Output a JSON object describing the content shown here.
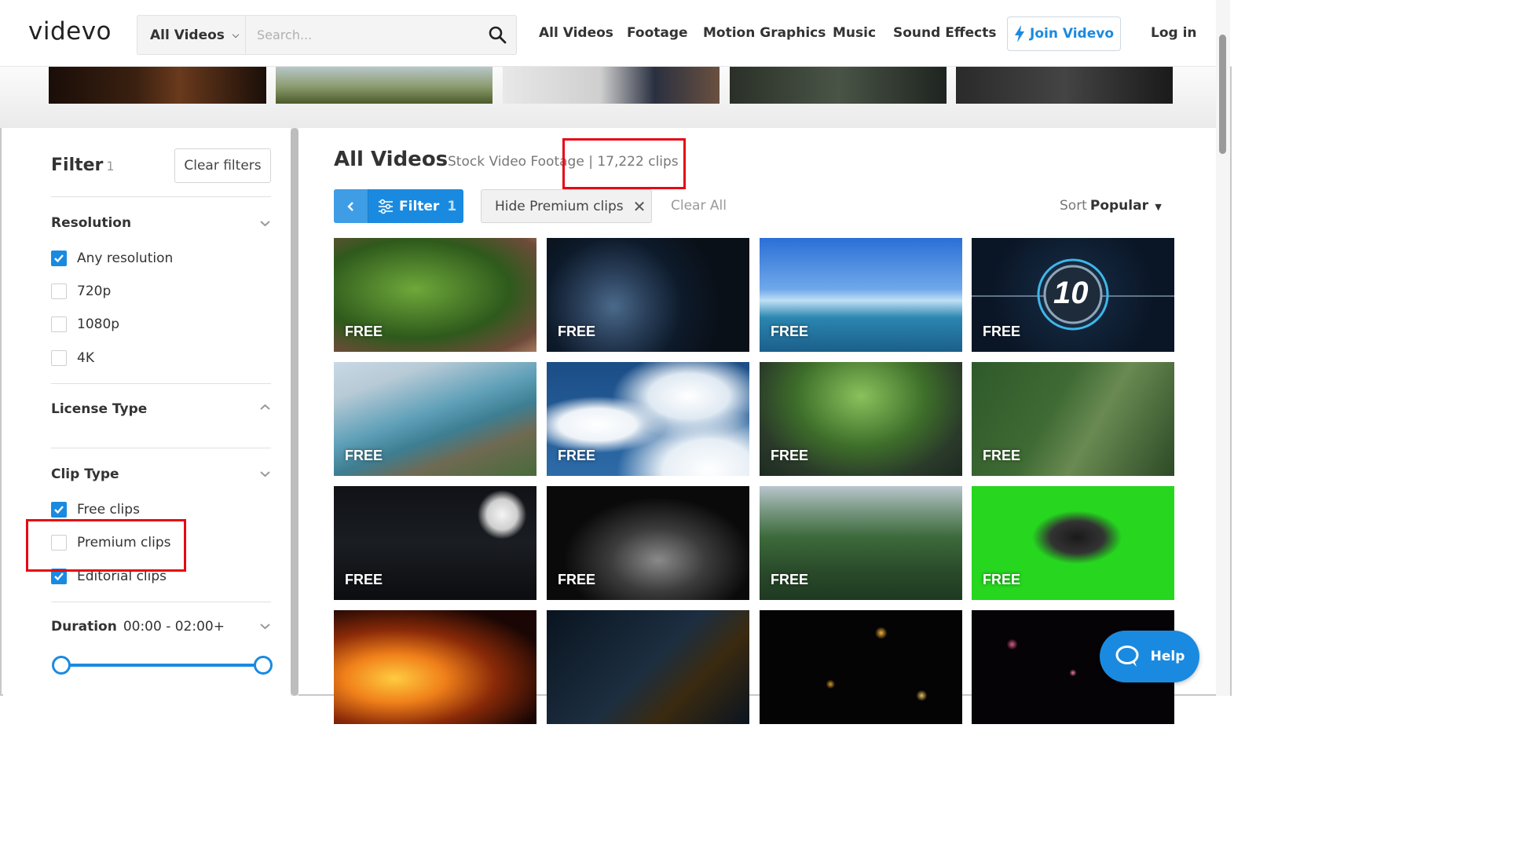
{
  "header": {
    "logo": "videvo",
    "search_category": "All Videos",
    "search_placeholder": "Search...",
    "nav": [
      "All Videos",
      "Footage",
      "Motion Graphics",
      "Music",
      "Sound Effects"
    ],
    "join_label": "Join Videvo",
    "login_label": "Log in"
  },
  "sidebar": {
    "filter_title": "Filter",
    "filter_count": "1",
    "clear_filters": "Clear filters",
    "resolution": {
      "title": "Resolution",
      "options": [
        {
          "label": "Any resolution",
          "checked": true
        },
        {
          "label": "720p",
          "checked": false
        },
        {
          "label": "1080p",
          "checked": false
        },
        {
          "label": "4K",
          "checked": false
        }
      ]
    },
    "license_type": {
      "title": "License Type"
    },
    "clip_type": {
      "title": "Clip Type",
      "options": [
        {
          "label": "Free clips",
          "checked": true
        },
        {
          "label": "Premium clips",
          "checked": false
        },
        {
          "label": "Editorial clips",
          "checked": true
        }
      ]
    },
    "duration": {
      "title": "Duration",
      "value": "00:00 - 02:00+"
    }
  },
  "main": {
    "title": "All Videos",
    "subtitle": "Stock Video Footage | 17,222 clips",
    "filter_button": "Filter",
    "filter_count": "1",
    "active_chip": "Hide Premium clips",
    "clear_all": "Clear All",
    "sort_label": "Sort",
    "sort_value": "Popular",
    "badge": "FREE"
  },
  "help_label": "Help",
  "colors": {
    "accent": "#1a8ae0",
    "annotation": "#e50914"
  }
}
